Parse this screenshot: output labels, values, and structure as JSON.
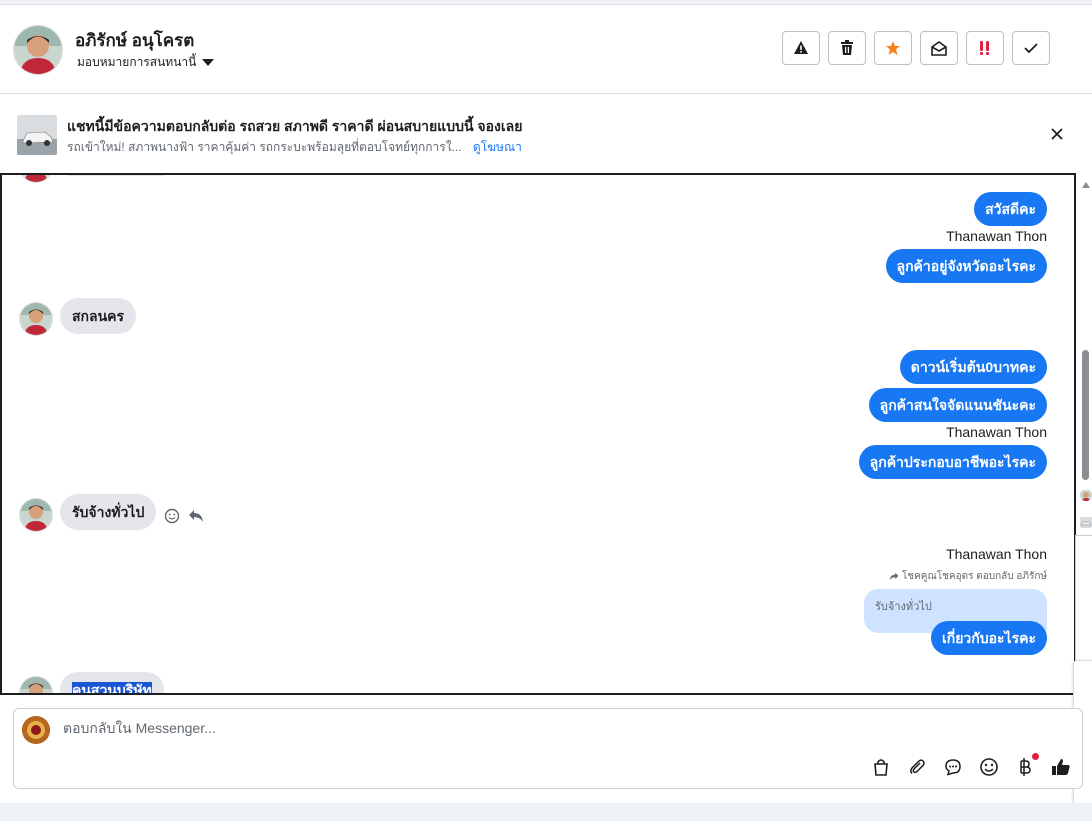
{
  "header": {
    "contact_name": "อภิรักษ์ อนุโครต",
    "assign_label": "มอบหมายการสนทนานี้"
  },
  "ad": {
    "title": "แชทนี้มีข้อความตอบกลับต่อ รถสวย สภาพดี ราคาดี ผ่อนสบายแบบนี้ จองเลย",
    "subtitle": "รถเข้าใหม่! สภาพนางฟ้า ราคาคุ้มค่า รถกระบะพร้อมลุยที่ตอบโจทย์ทุกการใ...",
    "link": "ดูโฆษณา"
  },
  "messages": {
    "out1": "สวัสดีคะ",
    "sender1": "Thanawan Thon",
    "out2": "ลูกค้าอยู่จังหวัดอะไรคะ",
    "in1": "สกลนคร",
    "out3": "ดาวน์เริ่มต้น0บาทคะ",
    "out4": "ลูกค้าสนใจจัดแนนชันะคะ",
    "sender2": "Thanawan Thon",
    "out5": "ลูกค้าประกอบอาชีพอะไรคะ",
    "in2": "รับจ้างทั่วไป",
    "sender3": "Thanawan Thon",
    "reply_meta": "โชคคูณโชคอุดร ตอบกลับ อภิรักษ์",
    "quoted": "รับจ้างทั่วไป",
    "out6": "เกี่ยวกับอะไรคะ",
    "in3": "คนสวนบริษัท"
  },
  "composer": {
    "placeholder": "ตอบกลับใน Messenger..."
  },
  "colors": {
    "accent": "#1877f2",
    "incoming_bubble": "#e4e6eb",
    "quoted_bubble": "#cfe2ff",
    "star": "#f5821f",
    "urgent": "#e41e3f"
  }
}
